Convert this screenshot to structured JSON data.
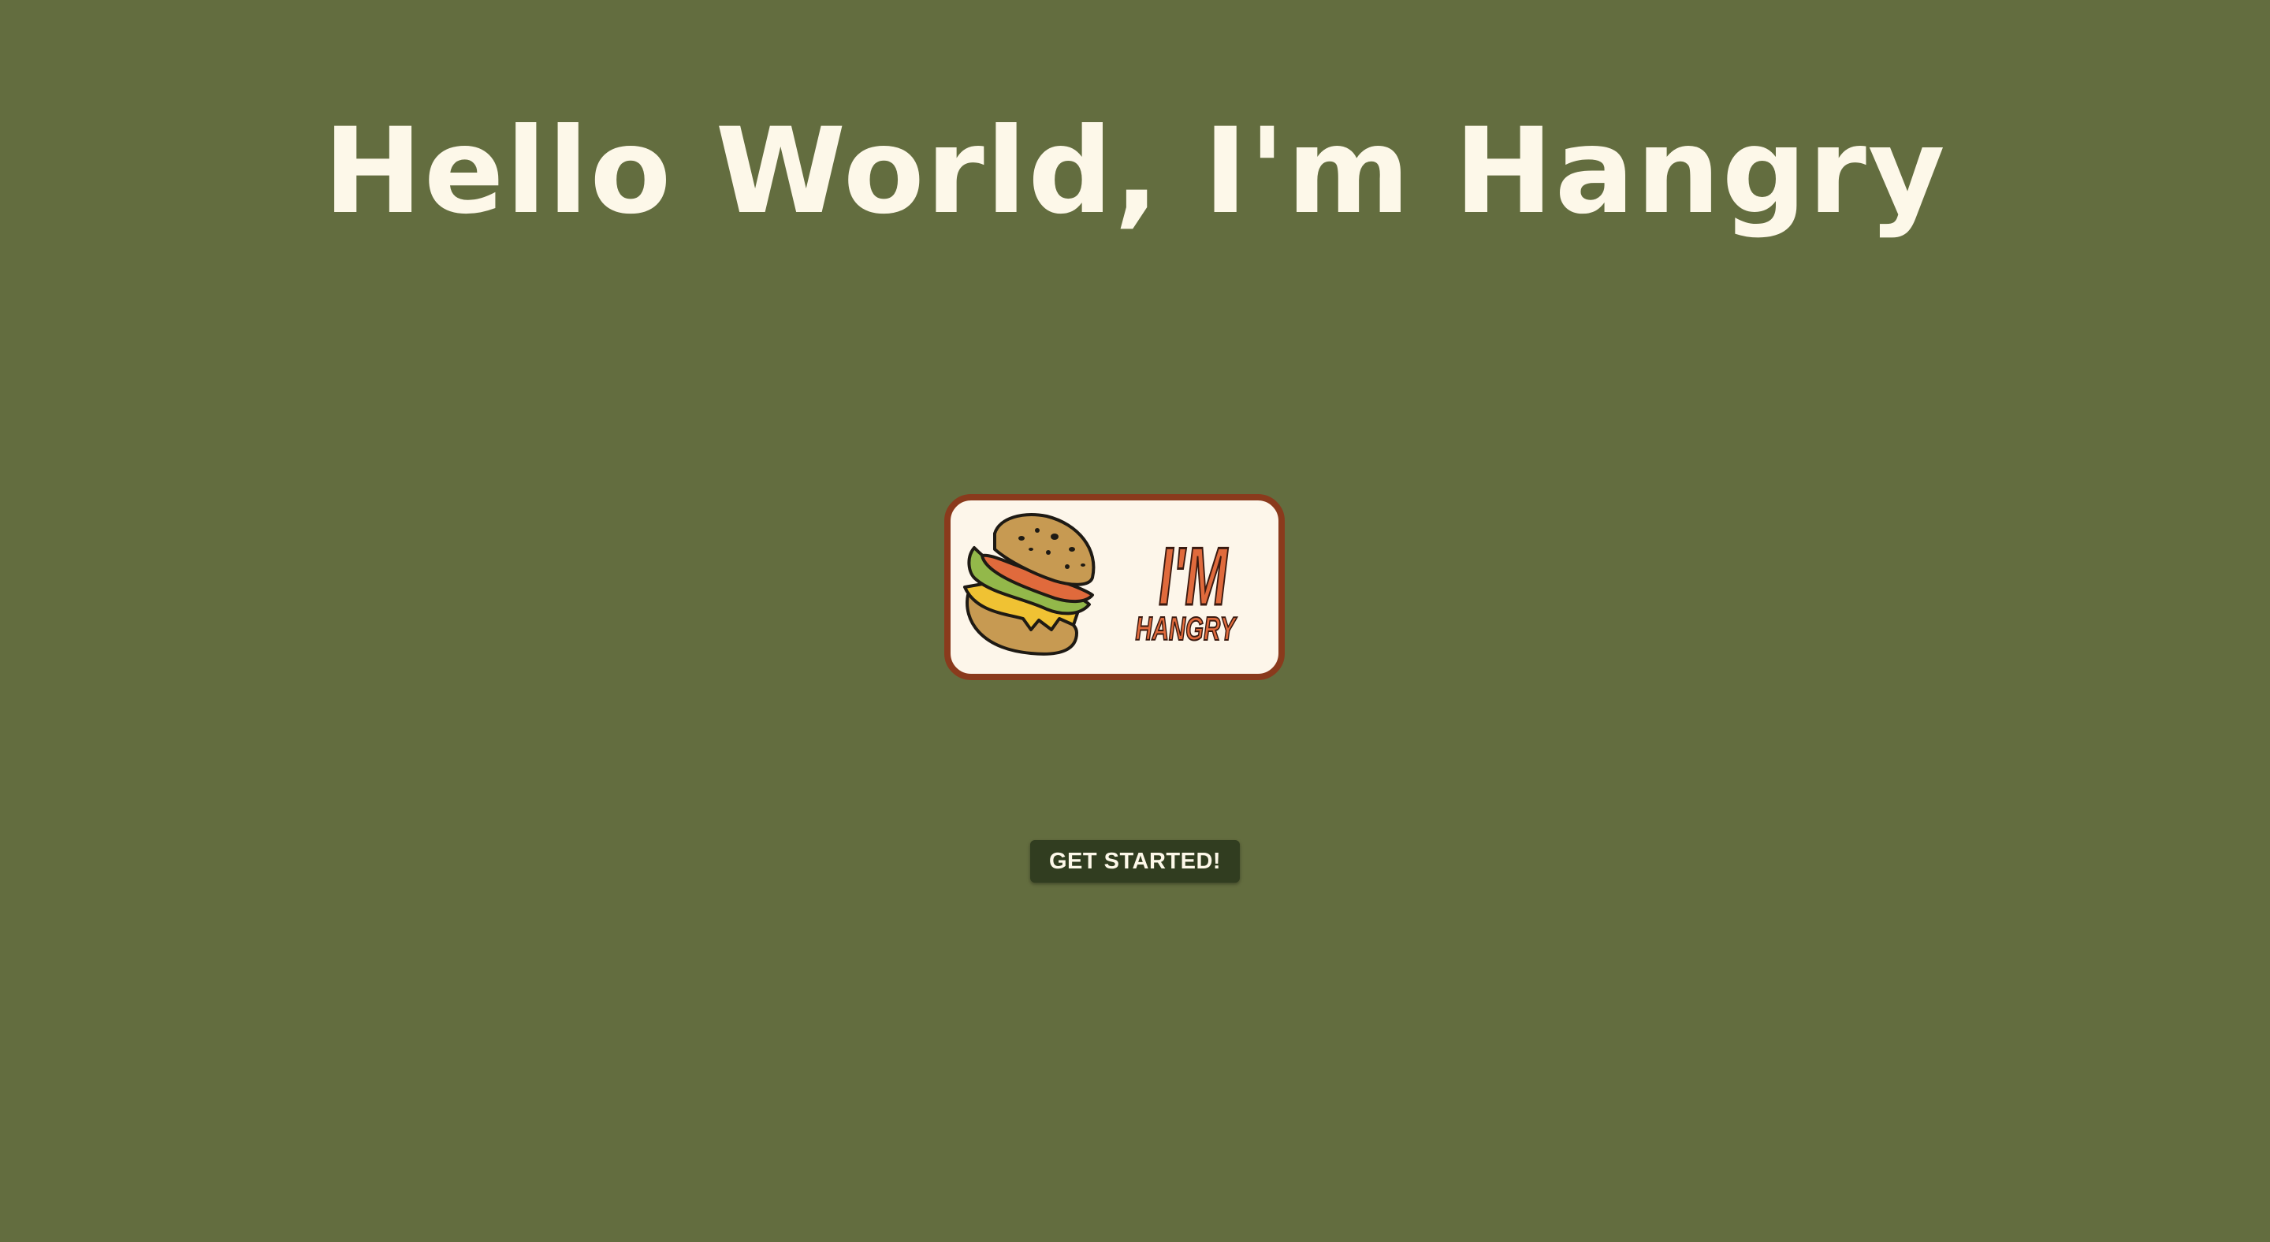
{
  "hero": {
    "title": "Hello World, I'm Hangry"
  },
  "logo": {
    "icon": "burger-icon",
    "line1": "I'M",
    "line2": "HANGRY"
  },
  "cta": {
    "label": "GET STARTED!"
  },
  "colors": {
    "background": "#636d3f",
    "title": "#fdf8e9",
    "button_bg": "#313d20",
    "button_text": "#fdf8e9",
    "logo_border": "#8a3a1c",
    "logo_fill": "#fdf6ea",
    "logo_text": "#e06a3c"
  }
}
